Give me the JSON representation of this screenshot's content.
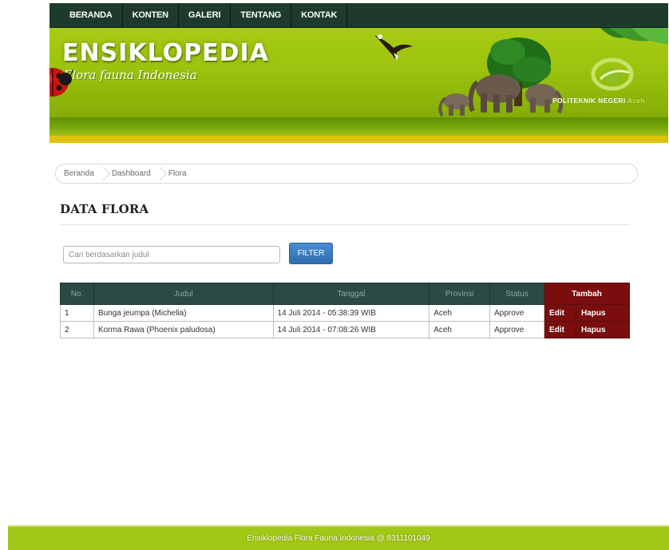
{
  "nav": {
    "items": [
      "BERANDA",
      "KONTEN",
      "GALERI",
      "TENTANG",
      "KONTAK"
    ]
  },
  "banner": {
    "title": "ENSIKLOPEDIA",
    "subtitle": "Flora fauna Indonesia",
    "institution_bold": "POLITEKNIK NEGERI",
    "institution_faint": "Aceh"
  },
  "breadcrumb": [
    "Beranda",
    "Dashboard",
    "Flora"
  ],
  "page_title": "DATA FLORA",
  "search": {
    "placeholder": "Cari berdasarkan judul",
    "value": "",
    "button_label": "FILTER"
  },
  "table": {
    "headers": [
      "No.",
      "Judul",
      "Tanggal",
      "Provinsi",
      "Status",
      "Tambah"
    ],
    "rows": [
      {
        "no": "1",
        "judul": "Bunga jeumpa (Michelia)",
        "tanggal": "14 Juli 2014 - 05:38:39 WIB",
        "provinsi": "Aceh",
        "status": "Approve",
        "edit": "Edit",
        "hapus": "Hapus"
      },
      {
        "no": "2",
        "judul": "Korma Rawa (Phoenix paludosa)",
        "tanggal": "14 Juli 2014 - 07:08:26 WIB",
        "provinsi": "Aceh",
        "status": "Approve",
        "edit": "Edit",
        "hapus": "Hapus"
      }
    ]
  },
  "footer": {
    "text": "Ensiklopedia Flora Fauna Indonesia @ 8311101049"
  },
  "colors": {
    "nav_bg": "#1d3a2a",
    "banner_green": "#9cc30e",
    "table_header": "#2c4a45",
    "action_red": "#7a0d0d",
    "filter_blue": "#2f6eb0",
    "footer_green": "#a3c716"
  },
  "icons": {
    "ladybug": "ladybug-icon",
    "eagle": "eagle-icon",
    "scene": "tree-elephants-illustration",
    "institution_logo": "politeknik-logo-icon"
  }
}
